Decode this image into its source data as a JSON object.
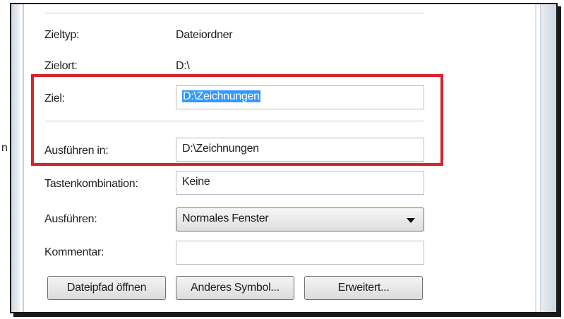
{
  "properties": {
    "zieltyp": {
      "label": "Zieltyp:",
      "value": "Dateiordner"
    },
    "zielort": {
      "label": "Zielort:",
      "value": "D:\\"
    },
    "ziel": {
      "label": "Ziel:",
      "value": "D:\\Zeichnungen"
    },
    "ausfuehren_in": {
      "label": "Ausführen in:",
      "value": "D:\\Zeichnungen"
    },
    "tastenkombination": {
      "label": "Tastenkombination:",
      "value": "Keine"
    },
    "ausfuehren": {
      "label": "Ausführen:",
      "selected": "Normales Fenster"
    },
    "kommentar": {
      "label": "Kommentar:",
      "value": ""
    }
  },
  "buttons": {
    "open_path": "Dateipfad öffnen",
    "change_icon": "Anderes Symbol...",
    "advanced": "Erweitert..."
  },
  "cropped_left_text": "n",
  "colors": {
    "highlight": "#d9232a",
    "selection": "#3399ff"
  }
}
